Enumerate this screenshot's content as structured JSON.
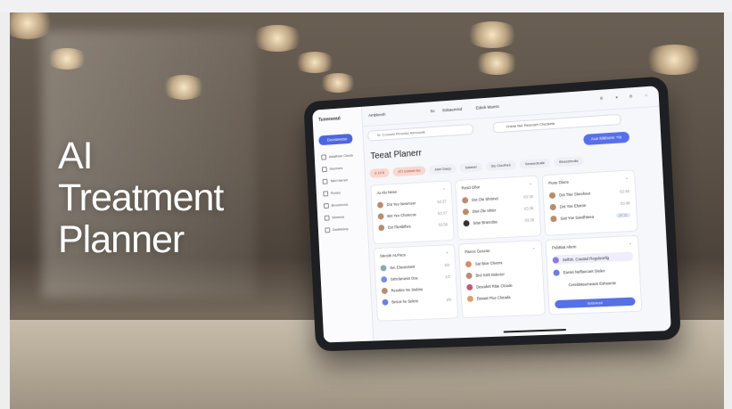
{
  "headline": {
    "line1": "AI",
    "line2": "Treatment",
    "line3": "Planner"
  },
  "app": {
    "brand": "Tuneesead",
    "topbar_left": "Ambleesh",
    "topbar_mid1": "Sc",
    "topbar_mid2": "Edsaemisd",
    "topbar_mid3": "Ederk Manss",
    "search_placeholder": "Sr. Conusid Pimoriss Adrecsate",
    "top_pill": "Chese Ner Resnoeh Chesketa",
    "title": "Teeat Planerr",
    "cta": "Aue Nibbons",
    "cta_suffix": "+to",
    "sidebar": {
      "active": "Dovsteeese",
      "items": [
        "Awathuis Clesia",
        "Seemies",
        "Tatd Harreit",
        "Ruries",
        "Buvesrions",
        "Sbmese",
        "Dadkksinp"
      ]
    },
    "chips": [
      "£ 13 8",
      "ATl Solhiell fse",
      "Jalel Daep",
      "Satesel",
      "Siy Cluolhee",
      "Sensedlodle",
      "Bhesdhrolle"
    ],
    "cards": [
      {
        "header": "Ju Alu Nese",
        "rows": [
          [
            "Dot Yeu Isewrceer",
            "53:37"
          ],
          [
            "Bot Yeo Chorecoe",
            "53:37"
          ],
          [
            "Eet Fliesbthes",
            "53:58"
          ]
        ]
      },
      {
        "header": "Resd Gfior",
        "rows": [
          [
            "Dot Ole Shrtmet",
            "03:39"
          ],
          [
            "Dtet Ole Shiicr",
            "03:38"
          ],
          [
            "Sdar Brancdse",
            "03:39"
          ]
        ]
      },
      {
        "header": "Puse Dloce",
        "rows": [
          [
            "Dot Tise Sheeheet",
            "02:49"
          ],
          [
            "Dot Yoe Efuiroe",
            "03:48"
          ],
          [
            "Sati Yoe Sandhteea",
            "20:31"
          ]
        ]
      },
      {
        "header": "Stecde ALPace",
        "rows": [
          [
            "Sw. Ehesresrelr",
            "5/0"
          ],
          [
            "Sshclaruess Ooe",
            "1/2"
          ],
          [
            "Resobre No Stebrie",
            ""
          ],
          [
            "Besoe he Selere",
            "2/0"
          ]
        ]
      },
      {
        "header": "Paece Gescse",
        "rows": [
          [
            "Sat Bioe Clivens",
            ""
          ],
          [
            "Biul Ssth Bslecier",
            ""
          ],
          [
            "Desodetl Rlae Cloode",
            ""
          ],
          [
            "Bssaat Flue Clorada",
            ""
          ]
        ]
      },
      {
        "header": "Pubttiat Aliere",
        "rows": [
          [
            "Selfoh. Coeatul Reguleorlig",
            ""
          ],
          [
            "Eanso Neffaecaet Sielee",
            ""
          ],
          [
            "Cereldsteemeaes Eshsoese",
            ""
          ]
        ],
        "button": "Setsnesd"
      }
    ]
  },
  "colors": {
    "accent": "#5770e8",
    "chip_selected": "#f8d8cf"
  }
}
